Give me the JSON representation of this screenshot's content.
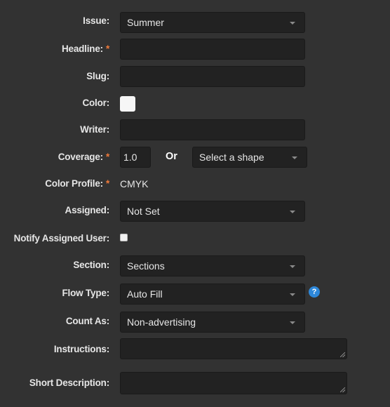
{
  "form": {
    "issue": {
      "label": "Issue:",
      "value": "Summer"
    },
    "headline": {
      "label": "Headline:",
      "required_mark": "*",
      "value": ""
    },
    "slug": {
      "label": "Slug:",
      "value": ""
    },
    "color": {
      "label": "Color:",
      "swatch_color": "#f6f6f6"
    },
    "writer": {
      "label": "Writer:",
      "value": ""
    },
    "coverage": {
      "label": "Coverage:",
      "required_mark": "*",
      "value": "1.0",
      "or_text": "Or",
      "shape_value": "Select a shape"
    },
    "color_profile": {
      "label": "Color Profile:",
      "required_mark": "*",
      "value": "CMYK"
    },
    "assigned": {
      "label": "Assigned:",
      "value": "Not Set"
    },
    "notify": {
      "label": "Notify Assigned User:",
      "checked": false
    },
    "section": {
      "label": "Section:",
      "value": "Sections"
    },
    "flow_type": {
      "label": "Flow Type:",
      "value": "Auto Fill",
      "help_glyph": "?"
    },
    "count_as": {
      "label": "Count As:",
      "value": "Non-advertising"
    },
    "instructions": {
      "label": "Instructions:",
      "value": ""
    },
    "short_description": {
      "label": "Short Description:",
      "value": ""
    }
  },
  "colors": {
    "background": "#323232",
    "field": "#222222",
    "required": "#f07a3a",
    "help": "#2d87d9"
  }
}
